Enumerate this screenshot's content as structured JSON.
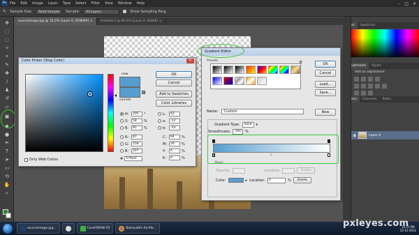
{
  "app": {
    "menu": [
      "File",
      "Edit",
      "Image",
      "Layer",
      "Type",
      "Select",
      "Filter",
      "View",
      "Window",
      "Help"
    ],
    "logo": "Ps"
  },
  "options": {
    "sample_size_label": "Sample Size:",
    "sample_size_value": "Point Sample",
    "sample_label": "Sample:",
    "sample_value": "All Layers",
    "show_ring_label": "Show Sampling Ring"
  },
  "documents": {
    "tabs": [
      "sourceimage.jpg @ 16.2% (Layer 0, RGB/8#) ×",
      "Untitled-1 @ 66.2% (Layer 0, RGB/8) ×"
    ]
  },
  "status_bar": "16.67%     Doc: 20.3M/22.2M",
  "panels": {
    "color_tabs": [
      "Color",
      "Swatches"
    ],
    "adjustment_tabs": [
      "Adjustments",
      "Styles"
    ],
    "add_adjustment": "Add an adjustment",
    "layers_tabs": [
      "Layers",
      "Channels",
      "Paths"
    ],
    "layer_name": "Layer 0"
  },
  "color_picker": {
    "title": "Color Picker (Stop Color)",
    "new_label": "new",
    "current_label": "current",
    "buttons": {
      "ok": "OK",
      "cancel": "Cancel",
      "add_swatches": "Add to Swatches",
      "color_libraries": "Color Libraries"
    },
    "fields_left": [
      {
        "label": "H:",
        "value": "205",
        "unit": "°",
        "selected": true
      },
      {
        "label": "S:",
        "value": "58",
        "unit": "%",
        "selected": false
      },
      {
        "label": "B:",
        "value": "81",
        "unit": "%",
        "selected": false
      },
      {
        "label": "R:",
        "value": "87",
        "unit": "",
        "selected": false
      },
      {
        "label": "G:",
        "value": "158",
        "unit": "",
        "selected": false
      },
      {
        "label": "B:",
        "value": "207",
        "unit": "",
        "selected": false
      }
    ],
    "fields_right": [
      {
        "label": "L:",
        "value": "62",
        "unit": ""
      },
      {
        "label": "a:",
        "value": "-12",
        "unit": ""
      },
      {
        "label": "b:",
        "value": "-33",
        "unit": ""
      },
      {
        "label": "C:",
        "value": "64",
        "unit": "%"
      },
      {
        "label": "M:",
        "value": "26",
        "unit": "%"
      },
      {
        "label": "Y:",
        "value": "4",
        "unit": "%"
      },
      {
        "label": "K:",
        "value": "0",
        "unit": "%"
      }
    ],
    "hex_label": "#",
    "hex_value": "579ecf",
    "web_only_label": "Only Web Colors",
    "color": "#579ecf"
  },
  "gradient_editor": {
    "title": "Gradient Editor",
    "presets_label": "Presets",
    "buttons": {
      "ok": "OK",
      "cancel": "Cancel",
      "load": "Load...",
      "save": "Save...",
      "new": "New"
    },
    "name_label": "Name:",
    "name_value": "Custom",
    "gradient_type_label": "Gradient Type:",
    "gradient_type_value": "Solid",
    "smoothness_label": "Smoothness:",
    "smoothness_value": "100",
    "smoothness_unit": "%",
    "stops_label": "Stops",
    "opacity_label": "Opacity:",
    "location_label": "Location:",
    "color_label": "Color:",
    "location_value": "0",
    "percent": "%",
    "delete_label": "Delete"
  },
  "taskbar": {
    "items": [
      "sourceimage.jpg...",
      "",
      "CorelDRAW X5",
      "Bahauddin Ka Ma..."
    ],
    "clock_time": "12:21 PM",
    "clock_date": "12-12-2012"
  },
  "watermark": "pxleyes.com",
  "accent": "#38c738"
}
